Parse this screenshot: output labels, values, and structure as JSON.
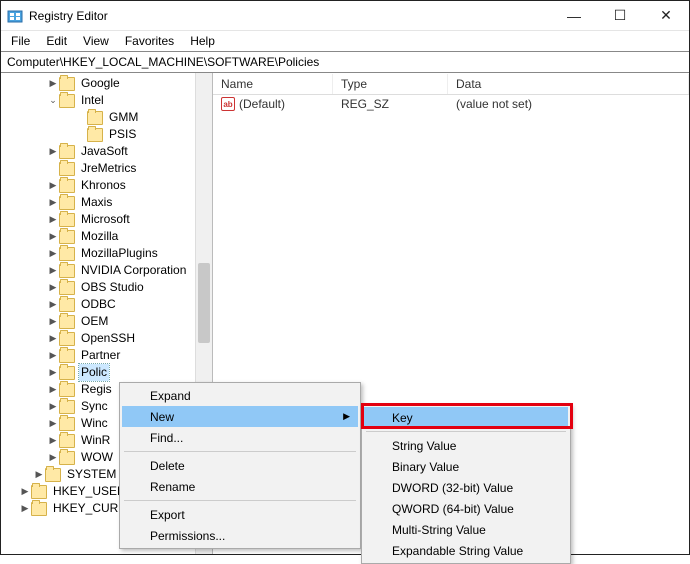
{
  "window": {
    "title": "Registry Editor",
    "buttons": {
      "min": "—",
      "max": "☐",
      "close": "✕"
    }
  },
  "menu": {
    "file": "File",
    "edit": "Edit",
    "view": "View",
    "favorites": "Favorites",
    "help": "Help"
  },
  "address": {
    "value": "Computer\\HKEY_LOCAL_MACHINE\\SOFTWARE\\Policies"
  },
  "tree": {
    "google": "Google",
    "intel": "Intel",
    "gmm": "GMM",
    "psis": "PSIS",
    "javasoft": "JavaSoft",
    "jremetrics": "JreMetrics",
    "khronos": "Khronos",
    "maxis": "Maxis",
    "microsoft": "Microsoft",
    "mozilla": "Mozilla",
    "mozillaplugins": "MozillaPlugins",
    "nvidia": "NVIDIA Corporation",
    "obs": "OBS Studio",
    "odbc": "ODBC",
    "oem": "OEM",
    "openssh": "OpenSSH",
    "partner": "Partner",
    "policies": "Polic",
    "regis": "Regis",
    "sync": "Sync",
    "winc": "Winc",
    "winr": "WinR",
    "wow": "WOW",
    "system": "SYSTEM",
    "hkey_user": "HKEY_USER",
    "hkey_cur": "HKEY_CUR"
  },
  "list": {
    "headers": {
      "name": "Name",
      "type": "Type",
      "data": "Data"
    },
    "row0": {
      "name": "(Default)",
      "type": "REG_SZ",
      "data": "(value not set)"
    }
  },
  "context_main": {
    "expand": "Expand",
    "new": "New",
    "find": "Find...",
    "delete": "Delete",
    "rename": "Rename",
    "export": "Export",
    "permissions": "Permissions..."
  },
  "context_sub": {
    "key": "Key",
    "string": "String Value",
    "binary": "Binary Value",
    "dword": "DWORD (32-bit) Value",
    "qword": "QWORD (64-bit) Value",
    "multi": "Multi-String Value",
    "expand": "Expandable String Value"
  }
}
